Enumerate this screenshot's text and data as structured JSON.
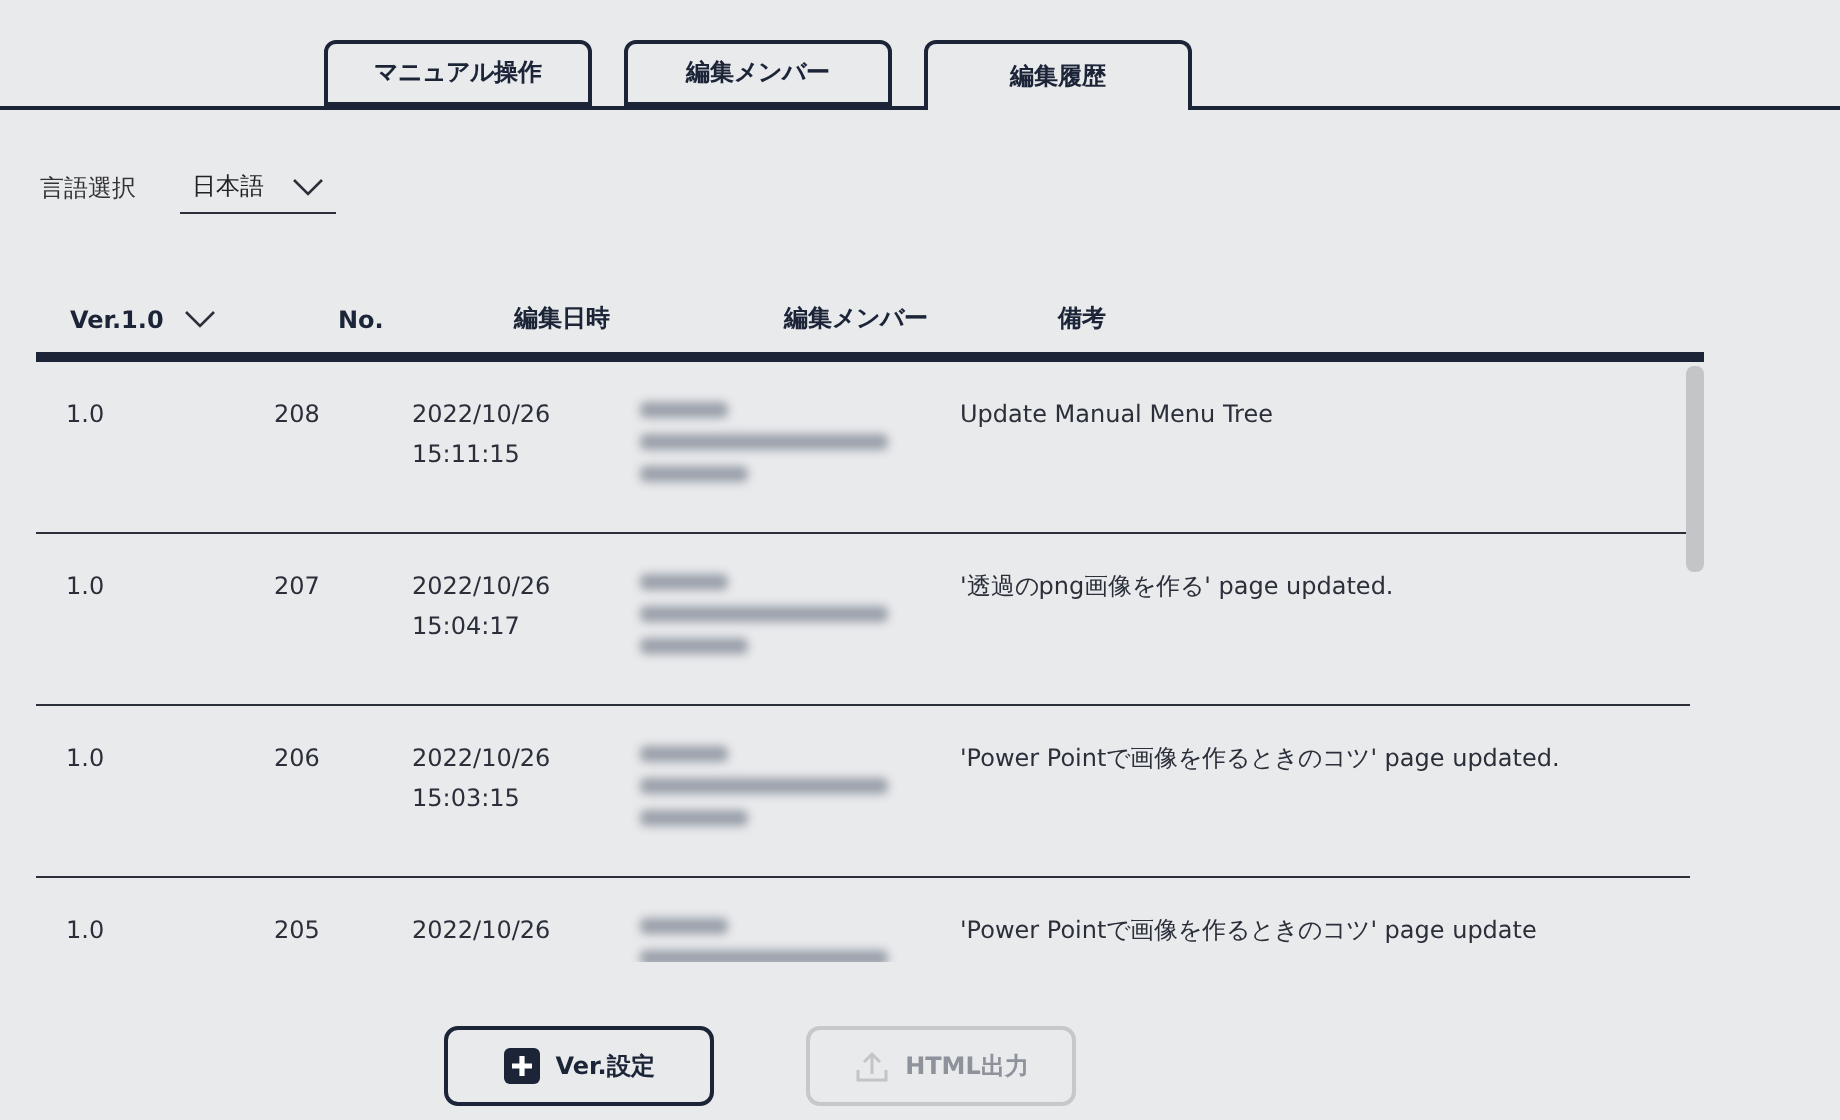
{
  "tabs": [
    {
      "label": "マニュアル操作",
      "selected": false
    },
    {
      "label": "編集メンバー",
      "selected": false
    },
    {
      "label": "編集履歴",
      "selected": true
    }
  ],
  "language": {
    "label": "言語選択",
    "value": "日本語"
  },
  "table": {
    "columns": [
      {
        "label": "Ver.1.0",
        "sortable": true
      },
      {
        "label": "No.",
        "sortable": false
      },
      {
        "label": "編集日時",
        "sortable": false
      },
      {
        "label": "編集メンバー",
        "sortable": false
      },
      {
        "label": "備考",
        "sortable": false
      }
    ],
    "rows": [
      {
        "version": "1.0",
        "no": "208",
        "datetime": "2022/10/26 15:11:15",
        "member_redacted": true,
        "remark": "Update Manual Menu Tree"
      },
      {
        "version": "1.0",
        "no": "207",
        "datetime": "2022/10/26 15:04:17",
        "member_redacted": true,
        "remark": "'透過のpng画像を作る' page updated."
      },
      {
        "version": "1.0",
        "no": "206",
        "datetime": "2022/10/26 15:03:15",
        "member_redacted": true,
        "remark": "'Power Pointで画像を作るときのコツ' page updated."
      },
      {
        "version": "1.0",
        "no": "205",
        "datetime": "2022/10/26",
        "member_redacted": true,
        "remark": "'Power Pointで画像を作るときのコツ' page update"
      }
    ]
  },
  "buttons": [
    {
      "kind": "add",
      "label": "Ver.設定",
      "disabled": false
    },
    {
      "kind": "export",
      "label": "HTML出力",
      "disabled": true
    }
  ]
}
